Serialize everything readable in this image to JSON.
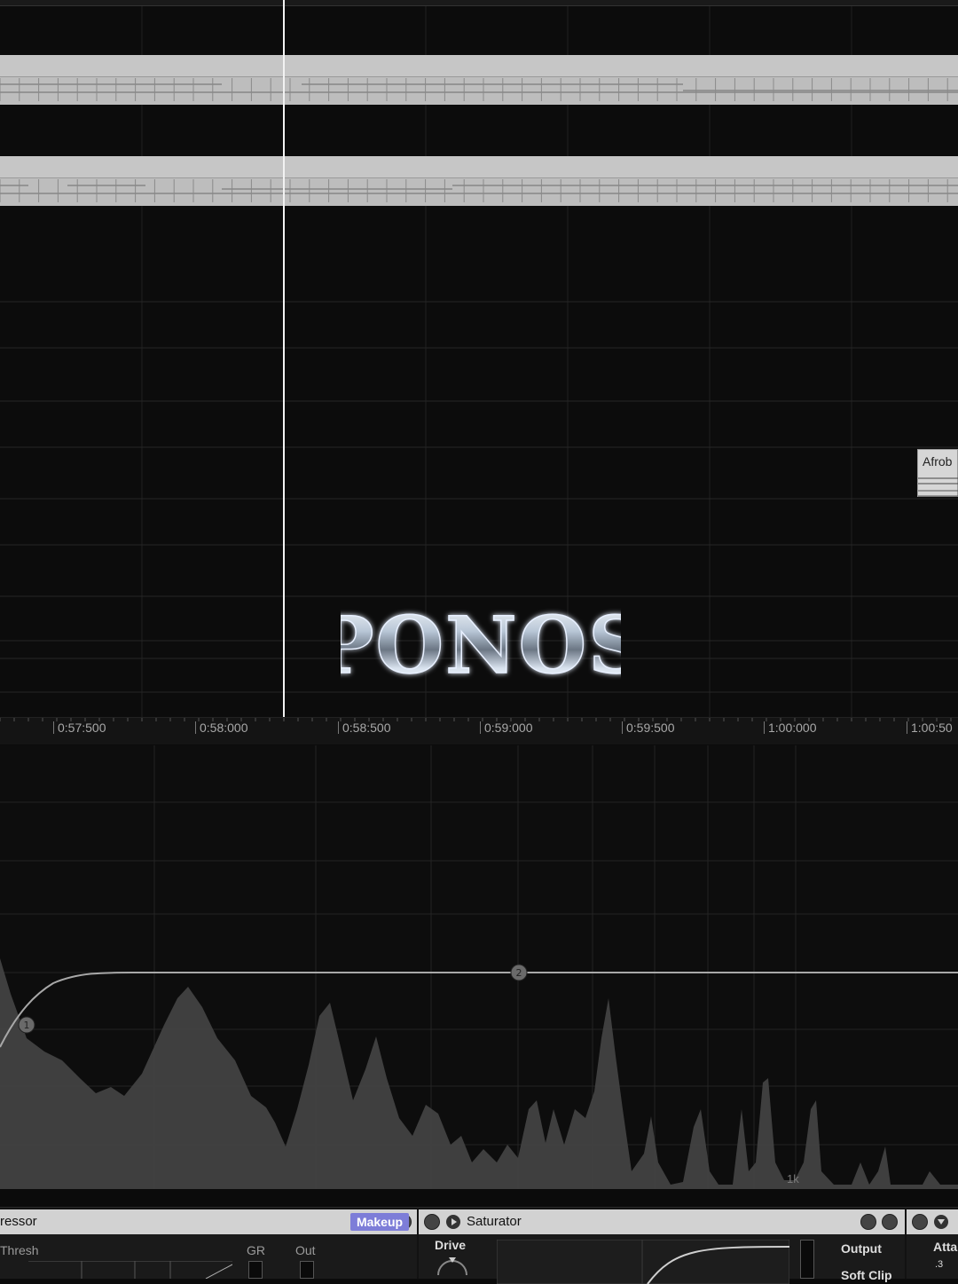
{
  "arrangement": {
    "clip_label": "Afrob"
  },
  "logo": {
    "text": "PONOS"
  },
  "ruler": {
    "ticks": [
      "0:57:500",
      "0:58:000",
      "0:58:500",
      "0:59:000",
      "0:59:500",
      "1:00:000",
      "1:00:50"
    ]
  },
  "spectrum": {
    "freq_label": "1k"
  },
  "devices": {
    "compressor": {
      "title": "ressor",
      "thresh_label": "Thresh",
      "gr_label": "GR",
      "out_label": "Out",
      "makeup_label": "Makeup"
    },
    "saturator": {
      "title": "Saturator",
      "drive_label": "Drive",
      "output_label": "Output",
      "softclip_label": "Soft Clip"
    },
    "third": {
      "attack_label": "Atta",
      "value_label": ".3"
    }
  },
  "colors": {
    "background": "#0b0b0b",
    "clip": "#c4c4c4",
    "playhead": "#f2f2f2",
    "makeup_active": "#7d7dd8",
    "device_title": "#d2d2d2"
  },
  "icons": [
    "power-icon",
    "save-icon",
    "hot-swap-icon",
    "play-icon",
    "fold-icon"
  ]
}
